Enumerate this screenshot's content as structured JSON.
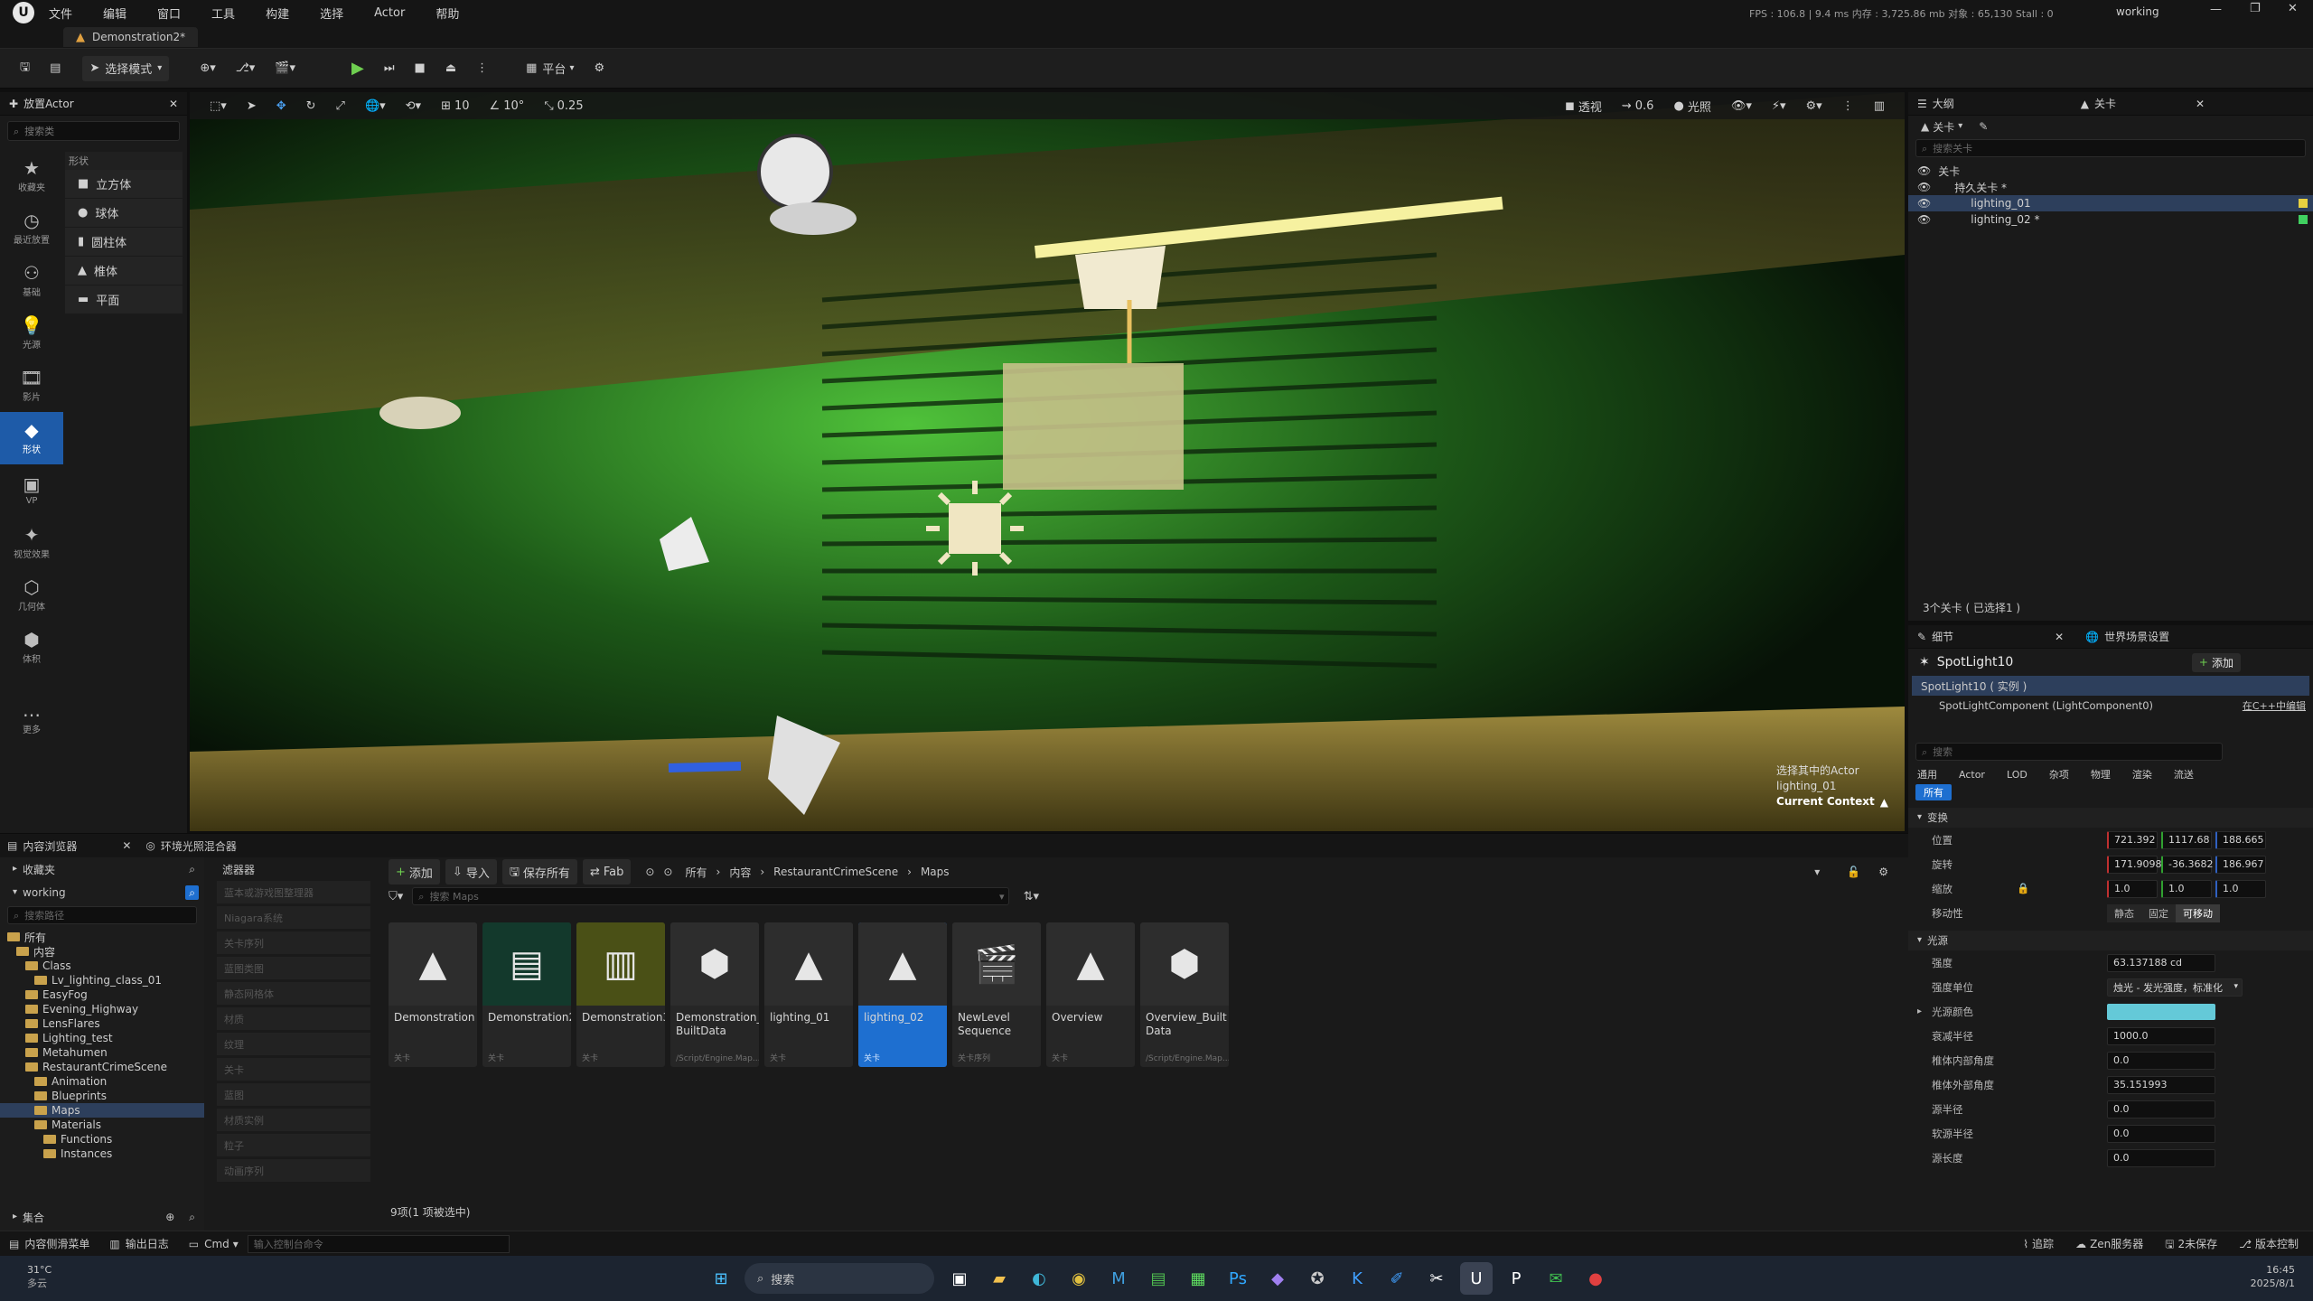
{
  "app": {
    "menu": [
      "文件",
      "编辑",
      "窗口",
      "工具",
      "构建",
      "选择",
      "Actor",
      "帮助"
    ],
    "stats": "FPS : 106.8  |  9.4 ms  内存 : 3,725.86 mb  对象 : 65,130  Stall : 0",
    "project": "working",
    "tab_title": "Demonstration2*"
  },
  "toolbar": {
    "mode_label": "选择模式",
    "platform_label": "平台"
  },
  "place_panel": {
    "title": "放置Actor",
    "search_placeholder": "搜索类",
    "categories": [
      "收藏夹",
      "最近放置",
      "基础",
      "光源",
      "影片",
      "形状",
      "VP",
      "视觉效果",
      "几何体",
      "体积",
      "更多"
    ],
    "section": "形状",
    "shapes": [
      "立方体",
      "球体",
      "圆柱体",
      "椎体",
      "平面"
    ]
  },
  "viewport": {
    "view_mode": "透视",
    "lit": "光照",
    "grid": "10",
    "rot": "10°",
    "scale": "0.25",
    "camera_speed": "0.6",
    "selected_label": "选择其中的Actor",
    "selected_actor": "lighting_01",
    "context": "Current Context"
  },
  "outliner": {
    "title": "大纲",
    "tab2": "关卡",
    "filter": "关卡",
    "search_placeholder": "搜索关卡",
    "rows": [
      "关卡",
      "持久关卡 *",
      "lighting_01",
      "lighting_02 *"
    ],
    "footer": "3个关卡 ( 已选择1 )"
  },
  "details": {
    "title": "细节",
    "tab2": "世界场景设置",
    "actor": "SpotLight10",
    "add_label": "添加",
    "instance": "SpotLight10 ( 实例 )",
    "component": "SpotLightComponent (LightComponent0)",
    "edit_cpp": "在C++中编辑",
    "search_placeholder": "搜索",
    "filters": [
      "通用",
      "Actor",
      "LOD",
      "杂项",
      "物理",
      "渲染",
      "流送"
    ],
    "filter_all": "所有",
    "transform_section": "变换",
    "location_label": "位置",
    "location": [
      "721.392",
      "1117.68",
      "188.665"
    ],
    "rotation_label": "旋转",
    "rotation": [
      "171.9098",
      "-36.3682",
      "186.967"
    ],
    "scale_label": "缩放",
    "scale": [
      "1.0",
      "1.0",
      "1.0"
    ],
    "mobility_label": "移动性",
    "mobility": [
      "静态",
      "固定",
      "可移动"
    ],
    "light_section": "光源",
    "intensity_label": "强度",
    "intensity": "63.137188 cd",
    "units_label": "强度单位",
    "units": "烛光 - 发光强度，标准化",
    "color_label": "光源颜色",
    "light_color": "#64c9d8",
    "attenuation_label": "衰减半径",
    "attenuation": "1000.0",
    "inner_cone_label": "椎体内部角度",
    "inner_cone": "0.0",
    "outer_cone_label": "椎体外部角度",
    "outer_cone": "35.151993",
    "source_radius_label": "源半径",
    "source_radius": "0.0",
    "soft_radius_label": "软源半径",
    "soft_radius": "0.0",
    "source_length_label": "源长度",
    "source_length": "0.0"
  },
  "content_browser": {
    "tab1": "内容浏览器",
    "tab2": "环境光照混合器",
    "favorites": "收藏夹",
    "project": "working",
    "search_placeholder": "搜索路径",
    "filters_title": "滤器器",
    "filter_items": [
      "蓝本或游戏图整理器",
      "Niagara系统",
      "关卡序列",
      "蓝图类图",
      "静态网格体",
      "材质",
      "纹理",
      "关卡",
      "蓝图",
      "材质实例",
      "粒子",
      "动画序列"
    ],
    "add": "添加",
    "import": "导入",
    "save_all": "保存所有",
    "fab": "Fab",
    "path": [
      "所有",
      "内容",
      "RestaurantCrimeScene",
      "Maps"
    ],
    "asset_search": "搜索 Maps",
    "tree": [
      {
        "label": "所有",
        "d": 0
      },
      {
        "label": "内容",
        "d": 1
      },
      {
        "label": "Class",
        "d": 2
      },
      {
        "label": "Lv_lighting_class_01",
        "d": 3
      },
      {
        "label": "EasyFog",
        "d": 2
      },
      {
        "label": "Evening_Highway",
        "d": 2
      },
      {
        "label": "LensFlares",
        "d": 2
      },
      {
        "label": "Lighting_test",
        "d": 2
      },
      {
        "label": "Metahumen",
        "d": 2
      },
      {
        "label": "RestaurantCrimeScene",
        "d": 2
      },
      {
        "label": "Animation",
        "d": 3
      },
      {
        "label": "Blueprints",
        "d": 3
      },
      {
        "label": "Maps",
        "d": 3
      },
      {
        "label": "Materials",
        "d": 3
      },
      {
        "label": "Functions",
        "d": 4
      },
      {
        "label": "Instances",
        "d": 4
      }
    ],
    "collections": "集合",
    "assets": [
      {
        "name": "Demonstration",
        "sub": "关卡",
        "kind": "map"
      },
      {
        "name": "Demonstration2",
        "sub": "关卡",
        "kind": "green"
      },
      {
        "name": "Demonstration3",
        "sub": "关卡",
        "kind": "yellow"
      },
      {
        "name": "Demonstration_ BuiltData",
        "sub": "/Script/Engine.Map...",
        "kind": "data"
      },
      {
        "name": "lighting_01",
        "sub": "关卡",
        "kind": "map"
      },
      {
        "name": "lighting_02",
        "sub": "关卡",
        "kind": "map"
      },
      {
        "name": "NewLevel Sequence",
        "sub": "关卡序列",
        "kind": "seq"
      },
      {
        "name": "Overview",
        "sub": "关卡",
        "kind": "map"
      },
      {
        "name": "Overview_Built Data",
        "sub": "/Script/Engine.Map...",
        "kind": "data"
      }
    ],
    "count": "9项(1 项被选中)"
  },
  "status_bar": {
    "drawer": "内容侧滑菜单",
    "output": "输出日志",
    "cmd": "Cmd",
    "cmd_placeholder": "输入控制台命令",
    "trace": "追踪",
    "zen": "Zen服务器",
    "unsaved": "2未保存",
    "revision": "版本控制"
  },
  "taskbar": {
    "weather_temp": "31°C",
    "weather": "多云",
    "search": "搜索",
    "time": "16:45",
    "date": "2025/8/1"
  }
}
